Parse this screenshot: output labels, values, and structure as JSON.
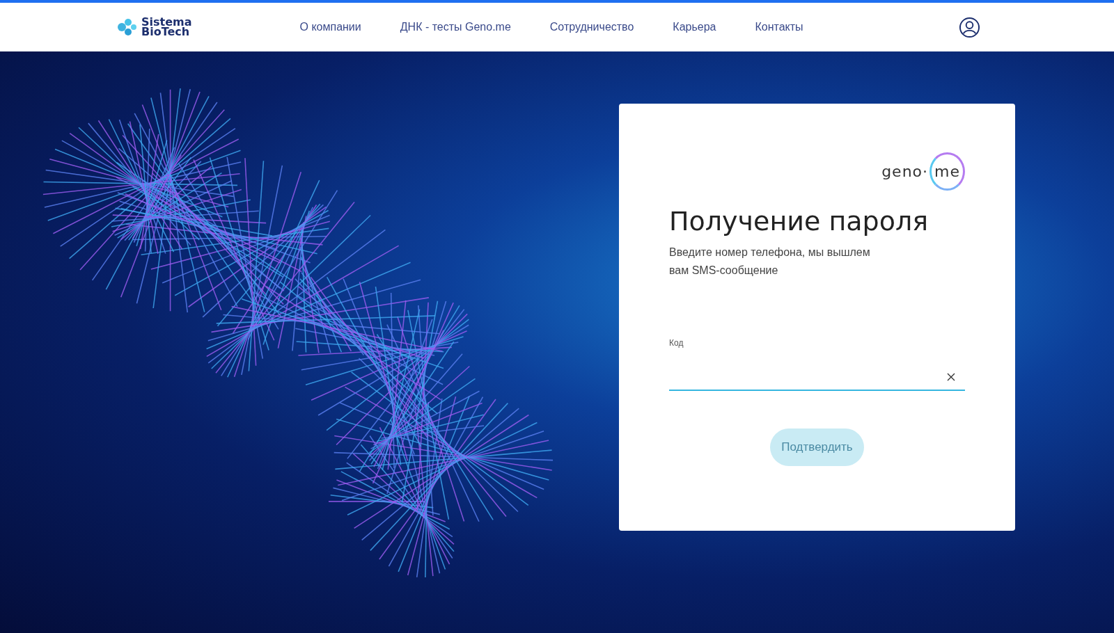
{
  "header": {
    "logo": {
      "line_1": "Sistema",
      "line_2": "BioTech"
    },
    "nav": [
      {
        "label": "О компании"
      },
      {
        "label": "ДНК - тесты Geno.me"
      },
      {
        "label": "Сотрудничество"
      },
      {
        "label": "Карьера"
      },
      {
        "label": "Контакты"
      }
    ]
  },
  "form": {
    "logo": {
      "word_1": "geno",
      "dot": "·",
      "word_2": "me"
    },
    "title": "Получение пароля",
    "description": "Введите номер телефона, мы вышлем вам SMS-сообщение",
    "field": {
      "label": "Код"
    },
    "button": {
      "label": "Подтвердить",
      "disabled": true
    }
  }
}
